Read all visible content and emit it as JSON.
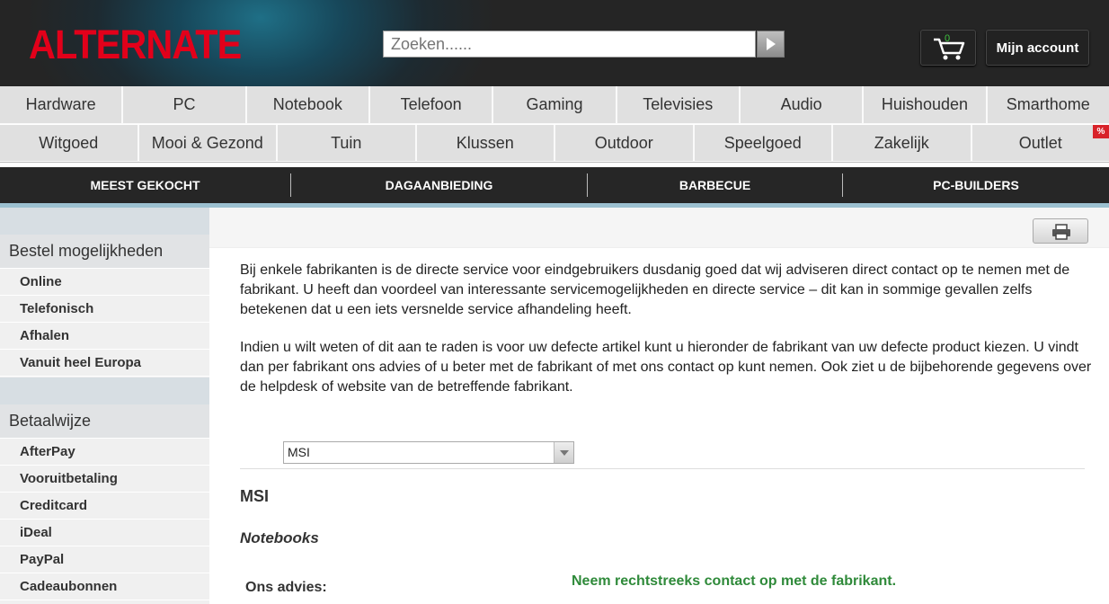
{
  "header": {
    "logo": "ALTERNATE",
    "search_placeholder": "Zoeken......",
    "cart_count": "0",
    "account_label": "Mijn account"
  },
  "categories_row1": [
    "Hardware",
    "PC",
    "Notebook",
    "Telefoon",
    "Gaming",
    "Televisies",
    "Audio",
    "Huishouden",
    "Smarthome"
  ],
  "categories_row2": [
    "Witgoed",
    "Mooi & Gezond",
    "Tuin",
    "Klussen",
    "Outdoor",
    "Speelgoed",
    "Zakelijk",
    "Outlet"
  ],
  "outlet_badge": "%",
  "promo_bar": [
    "MEEST GEKOCHT",
    "DAGAANBIEDING",
    "BARBECUE",
    "PC-BUILDERS"
  ],
  "sidebar": {
    "section1_title": "Bestel mogelijkheden",
    "section1_items": [
      "Online",
      "Telefonisch",
      "Afhalen",
      "Vanuit heel Europa"
    ],
    "section2_title": "Betaalwijze",
    "section2_items": [
      "AfterPay",
      "Vooruitbetaling",
      "Creditcard",
      "iDeal",
      "PayPal",
      "Cadeaubonnen"
    ]
  },
  "main": {
    "paragraph1": "Bij enkele fabrikanten is de directe service voor eindgebruikers dusdanig goed dat wij adviseren direct contact op te nemen met de fabrikant. U heeft dan voordeel van interessante servicemogelijkheden en directe service – dit kan in sommige gevallen zelfs betekenen dat u een iets versnelde service afhandeling heeft.",
    "paragraph2": "Indien u wilt weten of dit aan te raden is voor uw defecte artikel kunt u hieronder de fabrikant van uw defecte product kiezen. U vindt dan per fabrikant ons advies of u beter met de fabrikant of met ons contact op kunt nemen. Ook ziet u de bijbehorende gegevens over de helpdesk of website van de betreffende fabrikant.",
    "manufacturer_select_value": "MSI",
    "brand_heading": "MSI",
    "category_heading": "Notebooks",
    "advice_label": "Ons advies:",
    "advice_value": "Neem rechtstreeks contact op met de fabrikant."
  },
  "colors": {
    "logo_red": "#e2001a",
    "advice_green": "#2f8a3a",
    "promo_bg": "#262626",
    "badge_red": "#d8232a"
  }
}
